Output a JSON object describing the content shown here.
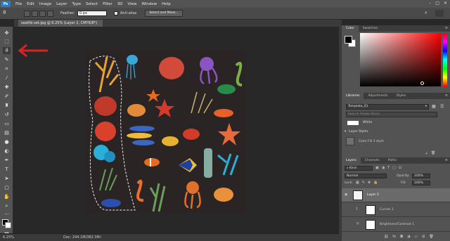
{
  "menubar": {
    "logo": "Ps",
    "items": [
      "File",
      "Edit",
      "Image",
      "Layer",
      "Type",
      "Select",
      "Filter",
      "3D",
      "View",
      "Window",
      "Help"
    ]
  },
  "options": {
    "feather_label": "Feather:",
    "feather_value": "0 px",
    "antialias_label": "Anti-alias",
    "select_mask": "Select and Mask..."
  },
  "document": {
    "tab_title": "sealife-set.jpg @ 6.25% (Layer 2, CMYK/8*)",
    "zoom": "6.25%",
    "doc_size": "Doc: 244.1M/382.3M"
  },
  "color_panel": {
    "tabs": [
      "Color",
      "Swatches"
    ],
    "fg": "#000000",
    "bg": "#ffffff"
  },
  "libraries_panel": {
    "tabs": [
      "Libraries",
      "Adjustments",
      "Styles"
    ],
    "library": "Template_01",
    "search_placeholder": "Search Adobe Stock",
    "top_item": "White",
    "section": "Layer Styles",
    "style_item": "Color Fill 3 style"
  },
  "layers_panel": {
    "tabs": [
      "Layers",
      "Channels",
      "Paths"
    ],
    "filter": "Kind",
    "blend_mode": "Normal",
    "opacity_label": "Opacity:",
    "opacity": "100%",
    "lock_label": "Lock:",
    "fill_label": "Fill:",
    "fill": "100%",
    "layers": [
      "Layer 2",
      "Curves 1",
      "Brightness/Contrast 1"
    ]
  },
  "annotation": {
    "color": "#e02020"
  }
}
